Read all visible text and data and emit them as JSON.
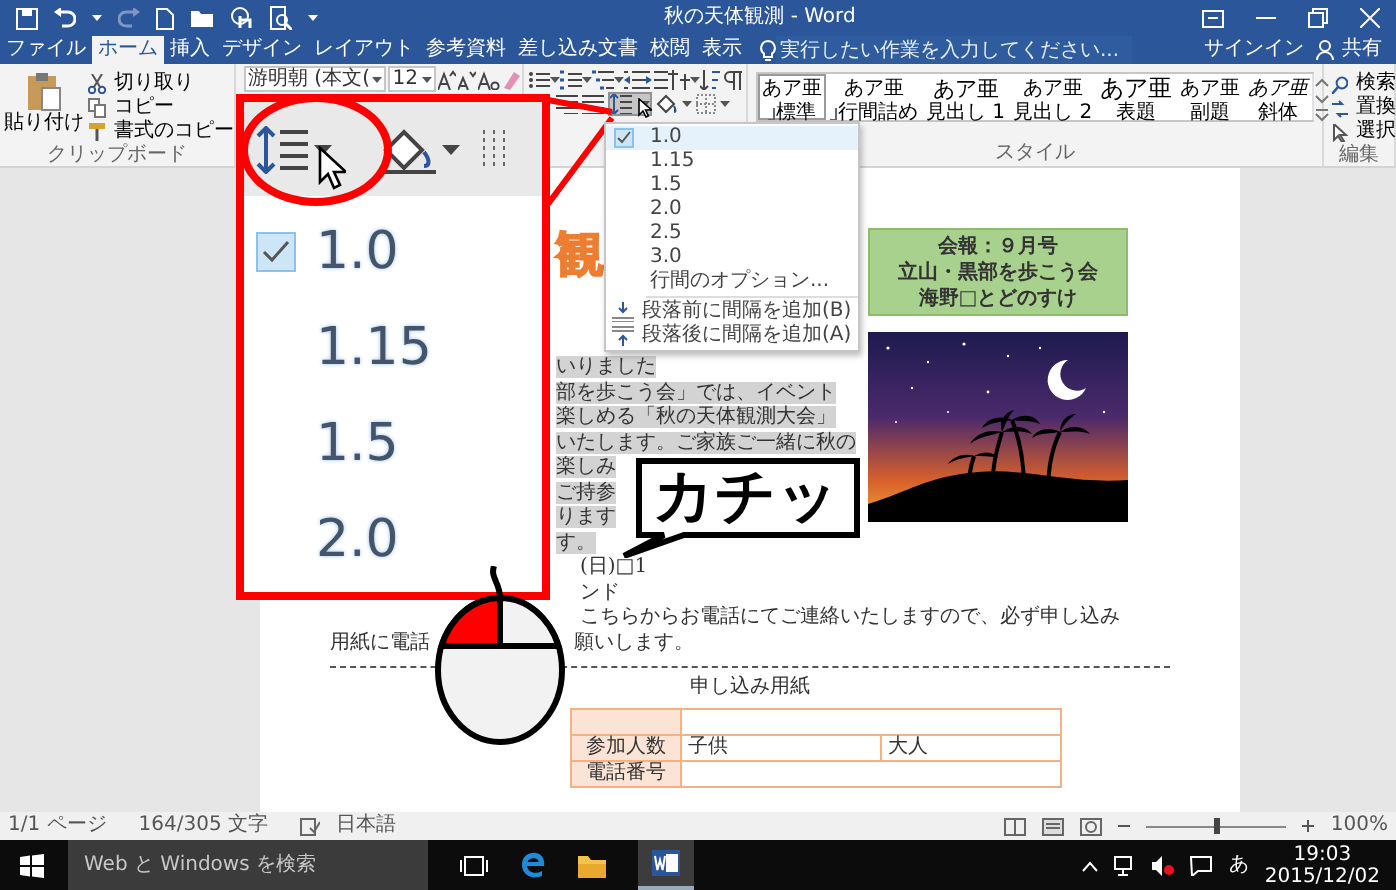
{
  "window": {
    "title": "秋の天体観測 - Word"
  },
  "tabs": [
    {
      "label": "ファイル",
      "selected": false
    },
    {
      "label": "ホーム",
      "selected": true
    },
    {
      "label": "挿入",
      "selected": false
    },
    {
      "label": "デザイン",
      "selected": false
    },
    {
      "label": "レイアウト",
      "selected": false
    },
    {
      "label": "参考資料",
      "selected": false
    },
    {
      "label": "差し込み文書",
      "selected": false
    },
    {
      "label": "校閲",
      "selected": false
    },
    {
      "label": "表示",
      "selected": false
    }
  ],
  "tell_me": {
    "placeholder": "実行したい作業を入力してください..."
  },
  "account": {
    "sign_in": "サインイン",
    "share": "共有"
  },
  "clipboard": {
    "paste": "貼り付け",
    "cut": "切り取り",
    "copy": "コピー",
    "format_painter": "書式のコピー",
    "group_label": "クリップボード"
  },
  "font": {
    "name": "游明朝 (本文(",
    "size": "12"
  },
  "paragraph": {
    "line_spacing_button": {
      "pressed": true
    }
  },
  "styles": {
    "items": [
      {
        "kind": "normal",
        "preview": "あア亜",
        "label": "標準",
        "selected": true
      },
      {
        "kind": "compact",
        "preview": "あア亜",
        "label": "行間詰め",
        "selected": false
      },
      {
        "kind": "heading1",
        "preview": "あア亜",
        "label": "見出し 1",
        "selected": false
      },
      {
        "kind": "heading2",
        "preview": "あア亜",
        "label": "見出し 2",
        "selected": false
      },
      {
        "kind": "title",
        "preview": "あア亜",
        "label": "表題",
        "selected": false
      },
      {
        "kind": "subtitle",
        "preview": "あア亜",
        "label": "副題",
        "selected": false
      },
      {
        "kind": "emphasis",
        "preview": "あア亜",
        "label": "斜体",
        "selected": false
      }
    ],
    "group_label": "スタイル"
  },
  "editing": {
    "find": "検索",
    "replace": "置換",
    "select": "選択",
    "group_label": "編集"
  },
  "line_spacing_menu": {
    "items": [
      {
        "label": "1.0",
        "checked": true
      },
      {
        "label": "1.15",
        "checked": false
      },
      {
        "label": "1.5",
        "checked": false
      },
      {
        "label": "2.0",
        "checked": false
      },
      {
        "label": "2.5",
        "checked": false
      },
      {
        "label": "3.0",
        "checked": false
      }
    ],
    "options": "行間のオプション...",
    "add_before": "段落前に間隔を追加(B)",
    "add_after": "段落後に間隔を追加(A)"
  },
  "callout": {
    "items": [
      {
        "label": "1.0",
        "checked": true
      },
      {
        "label": "1.15",
        "checked": false
      },
      {
        "label": "1.5",
        "checked": false
      },
      {
        "label": "2.0",
        "checked": false
      }
    ]
  },
  "speech_bubble": {
    "text": "カチッ"
  },
  "mouse": {
    "left_pressed": true
  },
  "document": {
    "title_fragment": "観",
    "bulletin": [
      "会報：９月号",
      "立山・黒部を歩こう会",
      "海野□とどのすけ"
    ],
    "selected_text": {
      "selected": true,
      "lines": [
        "いりました",
        "部を歩こう会」では、イベント",
        "楽しめる「秋の天体観測大会」",
        "いたします。ご家族ご一緒に秋の",
        "楽しみ",
        "ご持参",
        "ります",
        "す。"
      ]
    },
    "lines": [
      "(日)□1",
      "ンド",
      "こちらからお電話にてご連絡いたしますので、必ず申し込み"
    ],
    "split_line": [
      "用紙に電話",
      "願いします。"
    ],
    "form_title": "申し込み用紙",
    "table": {
      "rows": [
        {
          "kind": "blank"
        },
        {
          "kind": "split",
          "label": "参加人数",
          "values": [
            "子供",
            "大人"
          ]
        },
        {
          "kind": "single",
          "label": "電話番号"
        }
      ]
    }
  },
  "status_bar": {
    "page": "1/1 ページ",
    "words": "164/305 文字",
    "language": "日本語",
    "zoom": "100%",
    "zoom_slider": {
      "level": 0.5
    }
  },
  "taskbar": {
    "search_placeholder": "Web と Windows を検索",
    "ime": "あ",
    "time": "19:03",
    "date": "2015/12/02"
  }
}
